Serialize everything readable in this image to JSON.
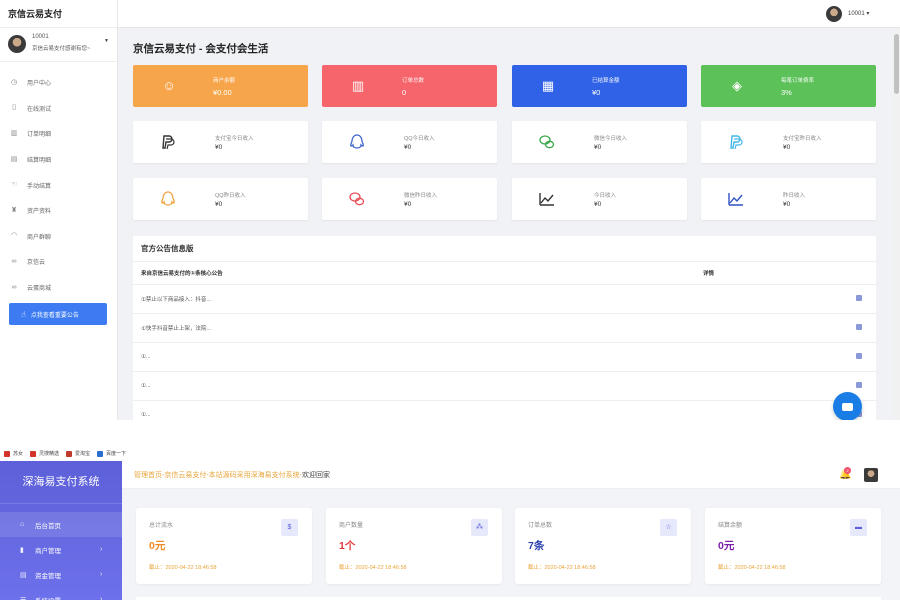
{
  "shot1": {
    "brand": "京信云易支付",
    "user": {
      "id": "10001",
      "name": "京信云易支付感谢有您~"
    },
    "nav": [
      {
        "label": "用户中心",
        "icon": "clock-icon"
      },
      {
        "label": "在线测试",
        "icon": "file-icon"
      },
      {
        "label": "订单明细",
        "icon": "bar-chart-icon"
      },
      {
        "label": "结算明细",
        "icon": "calendar-icon"
      },
      {
        "label": "手动结算",
        "icon": "hand-icon"
      },
      {
        "label": "资产资料",
        "icon": "trophy-icon"
      },
      {
        "label": "商户群聊",
        "icon": "bell-icon"
      },
      {
        "label": "京信云",
        "icon": "link-icon"
      },
      {
        "label": "云蛋商城",
        "icon": "link-icon"
      }
    ],
    "notice_button": "点我查看重要公告",
    "topbar_user": "10001",
    "page_title": "京信云易支付 - 会支付会生活",
    "stats": [
      {
        "label": "商户余额",
        "value": "¥0.00",
        "color": "#f7a54a",
        "icon": "smile-icon",
        "glyph": "☺"
      },
      {
        "label": "订单总数",
        "value": "0",
        "color": "#f5656b",
        "icon": "bar-chart-icon",
        "glyph": "▥"
      },
      {
        "label": "已结算金额",
        "value": "¥0",
        "color": "#2f62e6",
        "icon": "calculator-icon",
        "glyph": "▦"
      },
      {
        "label": "每笔订单费率",
        "value": "3%",
        "color": "#5cc159",
        "icon": "css3-icon",
        "glyph": "◈"
      }
    ],
    "income": [
      {
        "label": "支付宝今日收入",
        "value": "¥0",
        "icon": "paypal-icon"
      },
      {
        "label": "QQ今日收入",
        "value": "¥0",
        "icon": "qq-icon"
      },
      {
        "label": "微信今日收入",
        "value": "¥0",
        "icon": "wechat-icon"
      },
      {
        "label": "支付宝昨日收入",
        "value": "¥0",
        "icon": "paypal-icon"
      },
      {
        "label": "QQ昨日收入",
        "value": "¥0",
        "icon": "qq-icon"
      },
      {
        "label": "微信昨日收入",
        "value": "¥0",
        "icon": "wechat-icon"
      },
      {
        "label": "今日收入",
        "value": "¥0",
        "icon": "area-chart-icon"
      },
      {
        "label": "昨日收入",
        "value": "¥0",
        "icon": "area-chart-icon"
      }
    ],
    "notice_panel": {
      "title": "官方公告信息版",
      "col_title": "来自京信云易支付的①条核心公告",
      "col_detail": "详情",
      "rows": [
        "①禁止以下商品接入：抖音...",
        "①快手抖音禁止上架，法院...",
        "①...",
        "①...",
        "①..."
      ]
    }
  },
  "shot2": {
    "bookmarks": [
      "苏女",
      "灵搜精选",
      "爱淘宝",
      "百度一下"
    ],
    "logo": "深海易支付系统",
    "nav": [
      {
        "label": "后台首页",
        "icon": "home-icon",
        "arrow": ""
      },
      {
        "label": "商户管理",
        "icon": "bar-chart-icon",
        "arrow": "›"
      },
      {
        "label": "资金管理",
        "icon": "ledger-icon",
        "arrow": "›"
      },
      {
        "label": "系统设置",
        "icon": "menu-icon",
        "arrow": "›"
      }
    ],
    "crumb_link": "管理首页-京信云易支付-本站源码采用深海易支付系统-",
    "crumb_tail": "欢迎回家",
    "bell_count": "2",
    "cards": [
      {
        "label": "总计流水",
        "value": "0元",
        "time": "截止：2020-04-22 18:46:58",
        "color": "#f08a24",
        "icon": "dollar-icon",
        "glyph": "$"
      },
      {
        "label": "商户数量",
        "value": "1个",
        "time": "截止：2020-04-22 18:46:58",
        "color": "#e4373b",
        "icon": "users-icon",
        "glyph": "⁂"
      },
      {
        "label": "订单总数",
        "value": "7条",
        "time": "截止：2020-04-22 18:46:58",
        "color": "#2c3fb0",
        "icon": "cart-icon",
        "glyph": "☆"
      },
      {
        "label": "结算余额",
        "value": "0元",
        "time": "截止：2020-04-22 18:46:58",
        "color": "#7b1ea8",
        "icon": "money-icon",
        "glyph": "▬"
      }
    ]
  }
}
